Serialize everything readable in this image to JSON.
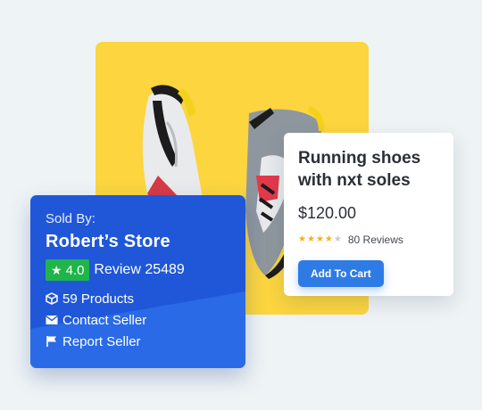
{
  "product": {
    "image_icon": "running-shoes-image",
    "title": "Running shoes with nxt soles",
    "price": "$120.00",
    "rating": {
      "stars_filled": 4,
      "stars_total": 5,
      "reviews_label": "80 Reviews"
    },
    "add_to_cart_label": "Add To Cart"
  },
  "seller": {
    "sold_by_label": "Sold By:",
    "store_name": "Robert’s Store",
    "rating_value": "4.0",
    "review_label": "Review 25489",
    "links": [
      {
        "icon": "box-icon",
        "label": "59 Products"
      },
      {
        "icon": "envelope-icon",
        "label": "Contact Seller"
      },
      {
        "icon": "flag-icon",
        "label": "Report Seller"
      }
    ]
  },
  "colors": {
    "background": "#eef3f5",
    "image_panel": "#fcd53f",
    "seller_card": "#1f57d8",
    "rating_badge": "#1fb54a",
    "button": "#2f7be5",
    "star_filled": "#f2b01e",
    "star_empty": "#c9ccd1"
  }
}
